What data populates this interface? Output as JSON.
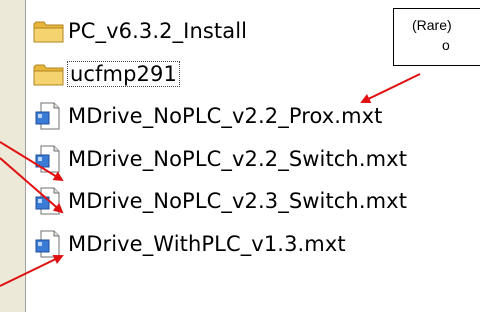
{
  "files": [
    {
      "name": "PC_v6.3.2_Install",
      "type": "folder",
      "icon": "folder-icon"
    },
    {
      "name": "ucfmp291",
      "type": "folder",
      "icon": "folder-icon",
      "selected": true
    },
    {
      "name": "MDrive_NoPLC_v2.2_Prox.mxt",
      "type": "file",
      "icon": "document-icon"
    },
    {
      "name": "MDrive_NoPLC_v2.2_Switch.mxt",
      "type": "file",
      "icon": "document-icon"
    },
    {
      "name": "MDrive_NoPLC_v2.3_Switch.mxt",
      "type": "file",
      "icon": "document-icon"
    },
    {
      "name": "MDrive_WithPLC_v1.3.mxt",
      "type": "file",
      "icon": "document-icon"
    }
  ],
  "callout": {
    "line1": "(Rare)",
    "line2": "o"
  },
  "colors": {
    "arrow": "#e01010",
    "folder": "#f2c94c",
    "pane": "#ece9d8"
  }
}
